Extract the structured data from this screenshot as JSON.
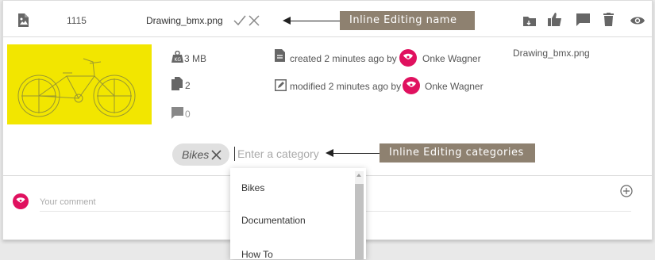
{
  "header": {
    "file_id": "1115",
    "file_name": "Drawing_bmx.png",
    "action_icons": [
      "folder-icon",
      "thumbs-up-icon",
      "comment-icon",
      "trash-icon",
      "eye-icon"
    ]
  },
  "callouts": {
    "name": "Inline Editing name",
    "categories": "Inline Editing categories"
  },
  "details": {
    "size": "3 MB",
    "versions": "2",
    "comments_count": "0",
    "created": "created 2 minutes ago by",
    "modified": "modified 2 minutes ago by",
    "author": "Onke Wagner",
    "right_name": "Drawing_bmx.png"
  },
  "categories": {
    "chip": "Bikes",
    "placeholder": "Enter a category",
    "options": [
      "Bikes",
      "Documentation",
      "How To"
    ]
  },
  "comment": {
    "placeholder": "Your comment"
  },
  "colors": {
    "thumbnail_bg": "#f2e600",
    "avatar": "#e0115f",
    "callout_bg": "#8e8170"
  }
}
